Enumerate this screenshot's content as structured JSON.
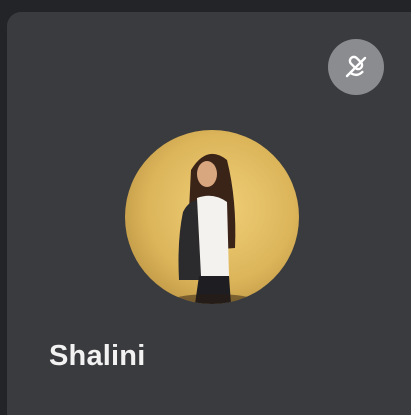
{
  "participant": {
    "name": "Shalini",
    "microphone": "muted",
    "mic_icon": "microphone-muted-icon",
    "avatar": "profile-photo"
  },
  "colors": {
    "background": "#232427",
    "tile": "#3a3b3e",
    "badge": "#8b8c90",
    "name_text": "#f2f2f2",
    "avatar_backdrop": "#e2bd5f"
  }
}
